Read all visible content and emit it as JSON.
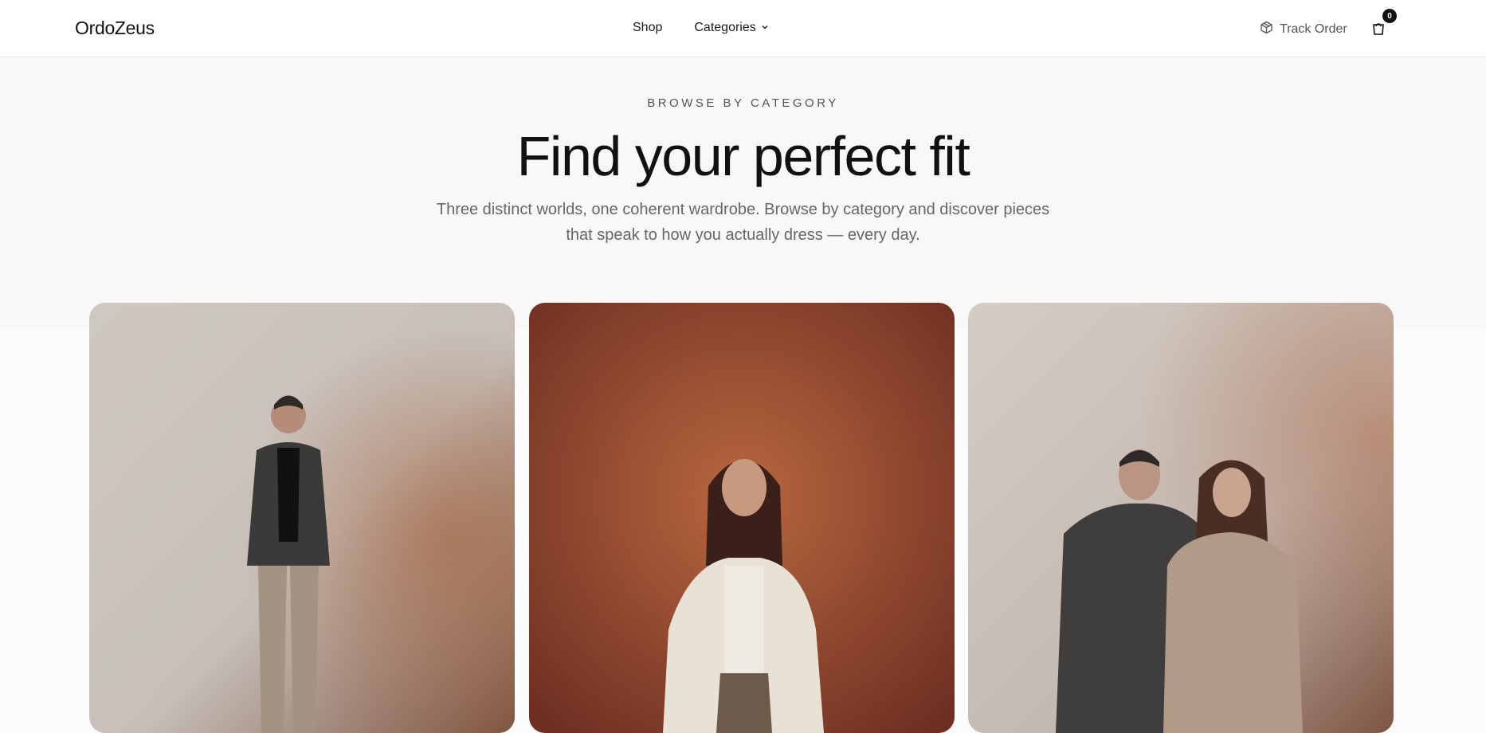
{
  "brand": {
    "name": "OrdoZeus"
  },
  "nav": {
    "shop_label": "Shop",
    "categories_label": "Categories"
  },
  "header_actions": {
    "track_order_label": "Track Order",
    "cart_count": "0"
  },
  "hero": {
    "eyebrow": "BROWSE BY CATEGORY",
    "title": "Find your perfect fit",
    "subtitle": "Three distinct worlds, one coherent wardrobe. Browse by category and discover pieces that speak to how you actually dress — every day."
  },
  "categories": [
    {
      "image": "man in charcoal blazer and beige trousers",
      "bg_color": "#d9d2cb",
      "accent_color": "#8c5a3a"
    },
    {
      "image": "woman in cream blazer on rust background",
      "bg_color": "#8a3f2c",
      "accent_color": "#b86a45"
    },
    {
      "image": "man in grey hoodie and woman in beige sweater",
      "bg_color": "#d7cbc1",
      "accent_color": "#9a6448"
    }
  ],
  "icons": {
    "chevron": "chevron-down-icon",
    "track": "package-icon",
    "cart": "shopping-bag-icon"
  }
}
